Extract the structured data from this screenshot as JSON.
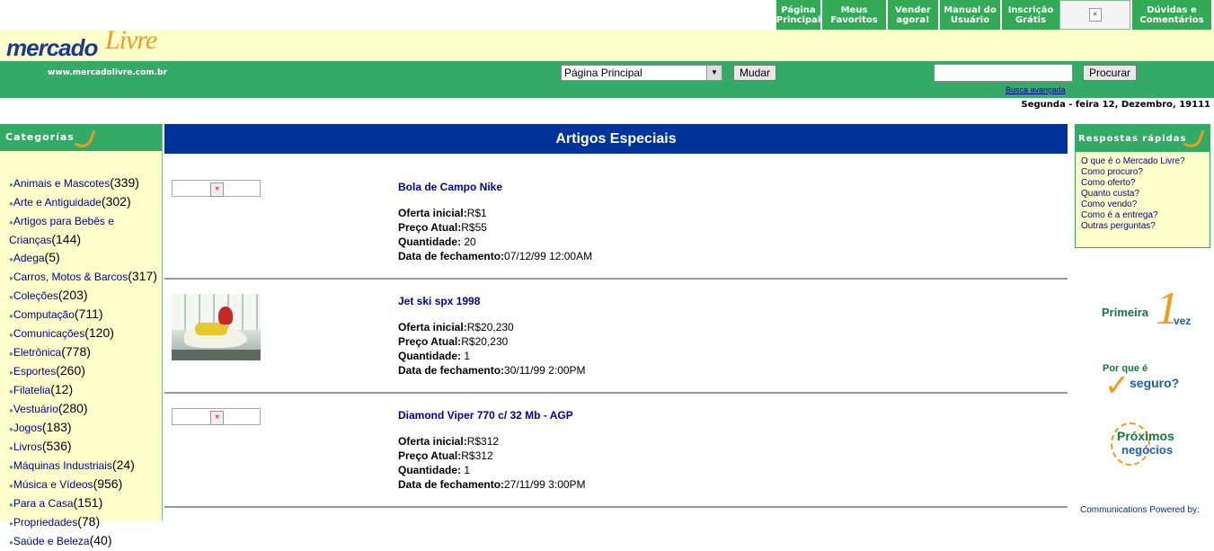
{
  "nav": {
    "items": [
      {
        "label": "Página\nPrincipal"
      },
      {
        "label": "Meus\nFavoritos"
      },
      {
        "label": "Vender\nagora!"
      },
      {
        "label": "Manual do\nUsuário"
      },
      {
        "label": "Inscrição\nGrátis"
      },
      {
        "label": ""
      },
      {
        "label": "Dúvidas e\nComentários"
      }
    ]
  },
  "logo": {
    "part1": "mercado",
    "part2": "Livre"
  },
  "site_url": "www.mercadolivre.com.br",
  "header": {
    "select_value": "Página Principal",
    "change_button": "Mudar",
    "search_button": "Procurar",
    "advanced_search": "Busca avançada",
    "date": "Segunda - feira 12, Dezembro, 19111"
  },
  "sidebar": {
    "title": "Categorías",
    "items": [
      {
        "label": "Animais e Mascotes",
        "count": "(339)"
      },
      {
        "label": "Arte e Antiguidade",
        "count": "(302)"
      },
      {
        "label": "Artigos para Bebês e Crianças",
        "count": "(144)"
      },
      {
        "label": "Adega",
        "count": "(5)"
      },
      {
        "label": "Carros, Motos & Barcos",
        "count": "(317)"
      },
      {
        "label": "Coleções",
        "count": "(203)"
      },
      {
        "label": "Computação",
        "count": "(711)"
      },
      {
        "label": "Comunicações",
        "count": "(120)"
      },
      {
        "label": "Eletrônica",
        "count": "(778)"
      },
      {
        "label": "Esportes",
        "count": "(260)"
      },
      {
        "label": "Filatelia",
        "count": "(12)"
      },
      {
        "label": "Vestuário",
        "count": "(280)"
      },
      {
        "label": "Jogos",
        "count": "(183)"
      },
      {
        "label": "Livros",
        "count": "(536)"
      },
      {
        "label": "Máquinas Industriais",
        "count": "(24)"
      },
      {
        "label": "Música e Vídeos",
        "count": "(956)"
      },
      {
        "label": "Para a Casa",
        "count": "(151)"
      },
      {
        "label": "Propriedades",
        "count": "(78)"
      },
      {
        "label": "Saúde e Beleza",
        "count": "(40)"
      }
    ]
  },
  "main": {
    "title": "Artigos Especiais",
    "items": [
      {
        "title": "Bola de Campo Nike",
        "oferta_label": "Oferta inicial:",
        "oferta": "R$1",
        "preco_label": "Preço Atual:",
        "preco": "R$55",
        "qtd_label": "Quantidade:",
        "qtd": "20",
        "data_label": "Data de fechamento:",
        "data": "07/12/99 12:00AM"
      },
      {
        "title": "Jet ski spx 1998",
        "oferta_label": "Oferta inicial:",
        "oferta": "R$20,230",
        "preco_label": "Preço Atual:",
        "preco": "R$20,230",
        "qtd_label": "Quantidade:",
        "qtd": "1",
        "data_label": "Data de fechamento:",
        "data": "30/11/99 2:00PM"
      },
      {
        "title": "Diamond Viper 770 c/ 32 Mb - AGP",
        "oferta_label": "Oferta inicial:",
        "oferta": "R$312",
        "preco_label": "Preço Atual:",
        "preco": "R$312",
        "qtd_label": "Quantidade:",
        "qtd": "1",
        "data_label": "Data de fechamento:",
        "data": "27/11/99 3:00PM"
      }
    ]
  },
  "right": {
    "title": "Respostas rápidas",
    "links": [
      "O que é o Mercado Livre?",
      "Como procuro?",
      "Como oferto?",
      "Quanto custa?",
      "Como vendo?",
      "Como é a entrega?",
      "Outras perguntas?"
    ],
    "promo1_a": "Primeira",
    "promo1_num": "1",
    "promo1_b": "vez",
    "promo2_a": "Por que é",
    "promo2_b": "seguro?",
    "promo3_a": "Próximos",
    "promo3_b": "negócios",
    "powered": "Communications Powered by:"
  },
  "colors": {
    "green": "#33aa66",
    "blue": "#003399",
    "cream": "#ffffcc",
    "orange": "#f39a1d"
  }
}
